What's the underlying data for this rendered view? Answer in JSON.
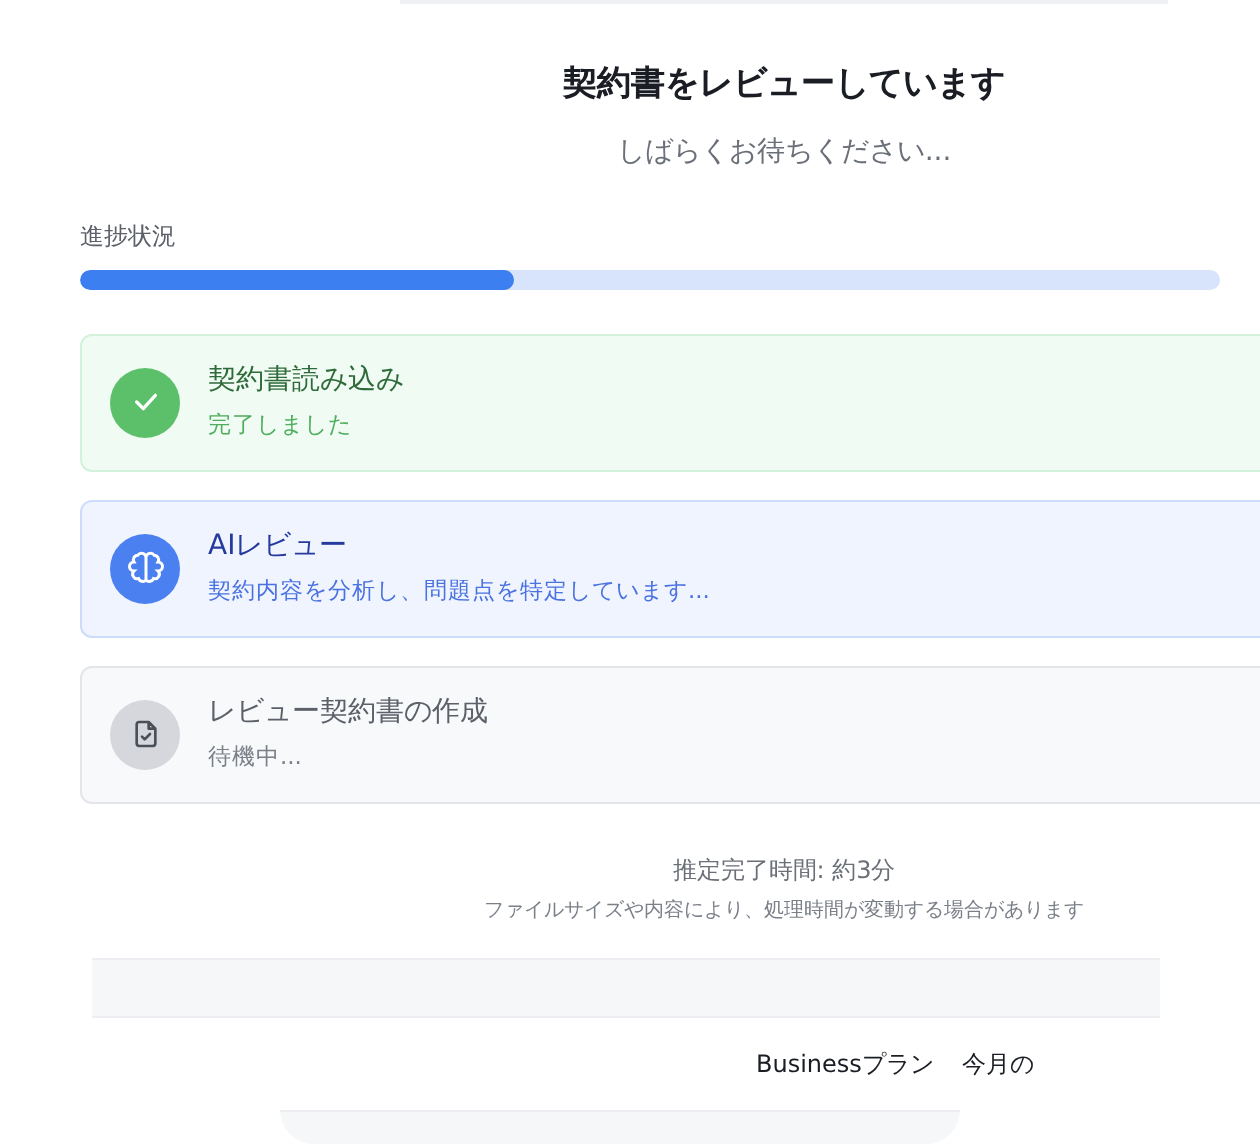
{
  "header": {
    "title": "契約書をレビューしています",
    "subtitle": "しばらくお待ちください..."
  },
  "progress": {
    "label": "進捗状況",
    "level": 0.38
  },
  "steps": [
    {
      "kind": "done",
      "title": "契約書読み込み",
      "status": "完了しました"
    },
    {
      "kind": "active",
      "title": "AIレビュー",
      "status": "契約内容を分析し、問題点を特定しています..."
    },
    {
      "kind": "pending",
      "title": "レビュー契約書の作成",
      "status": "待機中..."
    }
  ],
  "estimate": {
    "time": "推定完了時間: 約3分",
    "note": "ファイルサイズや内容により、処理時間が変動する場合があります"
  },
  "footer": {
    "plan": "Businessプラン",
    "usage": "今月の"
  }
}
